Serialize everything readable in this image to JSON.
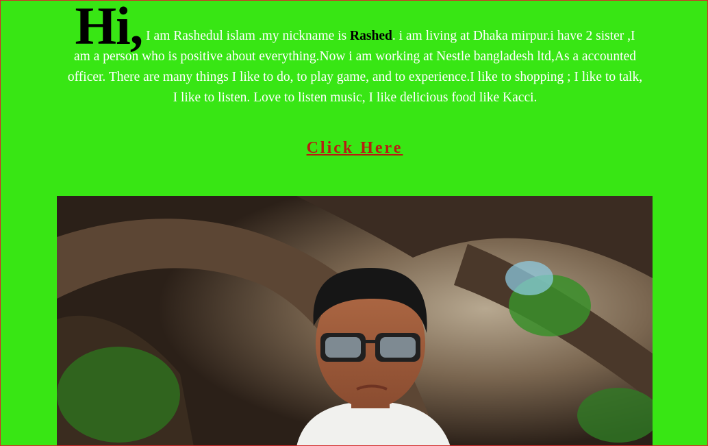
{
  "intro": {
    "greeting": "Hi,",
    "text_before_nick": " I am Rashedul islam .my nickname is ",
    "nickname": "Rashed",
    "text_after_nick": ". i am living at Dhaka mirpur.i have 2 sister ,I am a person who is positive about everything.Now i am working at Nestle bangladesh ltd,As a accounted officer. There are many things I like to do, to play game, and to experience.I like to shopping ; I like to talk, I like to listen. Love to listen music, I like delicious food like Kacci."
  },
  "cta": {
    "label": "Click Here"
  },
  "colors": {
    "background": "#38e614",
    "link": "#b81c12",
    "border": "#d62a2a"
  }
}
